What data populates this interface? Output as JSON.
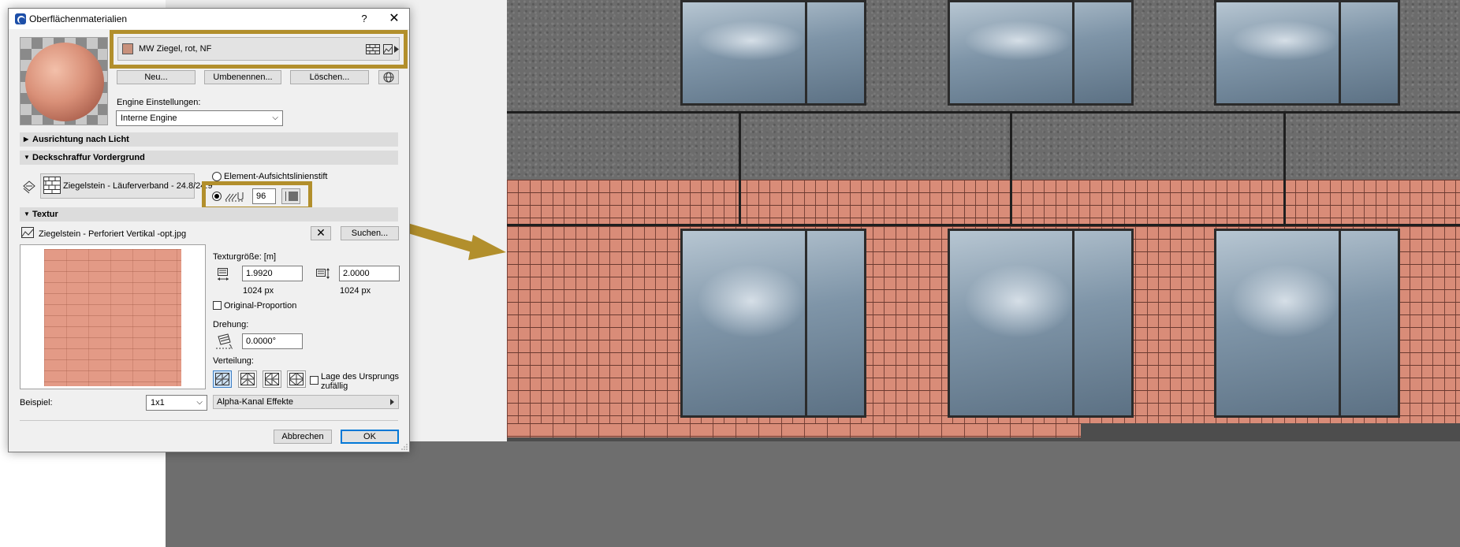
{
  "dialog": {
    "title": "Oberflächenmaterialien",
    "help": "?",
    "close": "✕",
    "material": {
      "name": "MW Ziegel, rot, NF",
      "swatch_color": "#c8917c"
    },
    "buttons": {
      "new": "Neu...",
      "rename": "Umbenennen...",
      "delete": "Löschen..."
    },
    "engine": {
      "label": "Engine Einstellungen:",
      "value": "Interne Engine"
    },
    "sections": {
      "light": "Ausrichtung nach Licht",
      "hatch": "Deckschraffur Vordergrund",
      "texture": "Textur"
    },
    "hatch": {
      "fill_name": "Ziegelstein - Läuferverband - 24.8/24.9",
      "option_element_pen": "Element-Aufsichtslinienstift",
      "pen_number": "96"
    },
    "texture": {
      "file": "Ziegelstein - Perforiert Vertikal -opt.jpg",
      "search": "Suchen...",
      "size_label": "Texturgröße: [m]",
      "width": "1.9920",
      "height": "2.0000",
      "width_px": "1024 px",
      "height_px": "1024 px",
      "original_proportion": "Original-Proportion",
      "rotation_label": "Drehung:",
      "rotation": "0.0000°",
      "distribution_label": "Verteilung:",
      "random_origin": "Lage des Ursprungs zufällig",
      "alpha": "Alpha-Kanal Effekte"
    },
    "example": {
      "label": "Beispiel:",
      "value": "1x1"
    },
    "footer": {
      "cancel": "Abbrechen",
      "ok": "OK"
    }
  },
  "colors": {
    "callout": "#b28f2c",
    "brick": "#d98c78",
    "concrete": "#6c6c6c"
  }
}
